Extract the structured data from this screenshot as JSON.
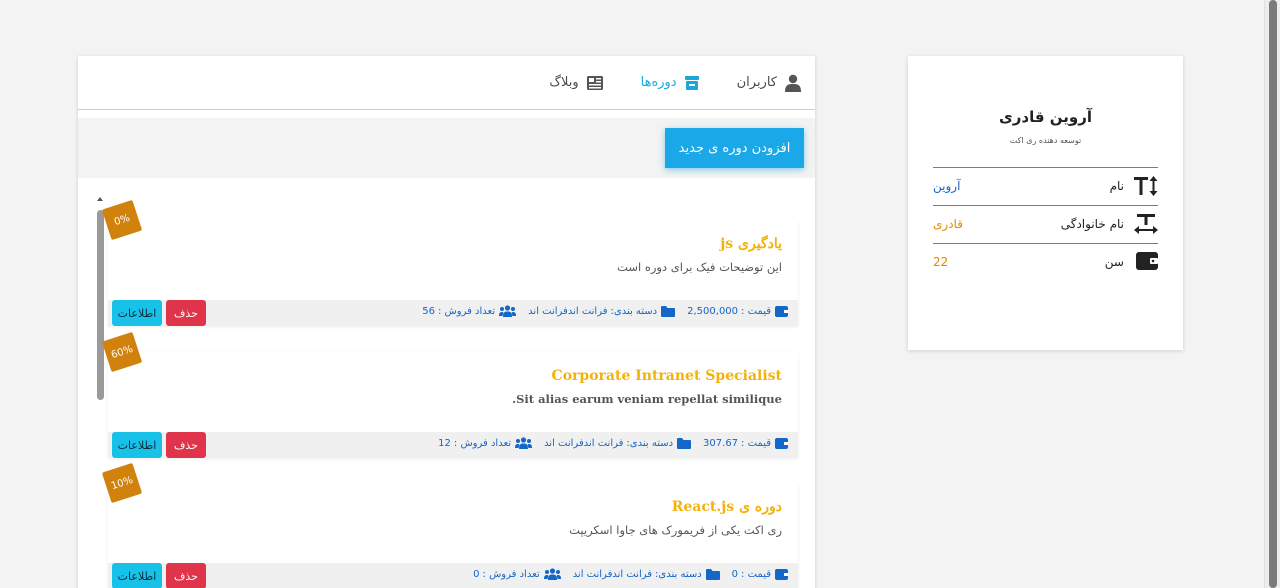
{
  "nav": {
    "users": "کاربران",
    "courses": "دوره‌ها",
    "blog": "وبلاگ"
  },
  "actions": {
    "add_course": "افزودن دوره ی جدید"
  },
  "labels": {
    "price": "قیمت :",
    "category": "دسته بندی:",
    "sales": "تعداد فروش :",
    "delete": "حذف",
    "info": "اطلاعات"
  },
  "courses": [
    {
      "badge": "0%",
      "title": "یادگیری js",
      "description": "این توضیحات فیک برای دوره است",
      "price": "2,500,000",
      "category": "فرانت اندفرانت اند",
      "sales": "56"
    },
    {
      "badge": "60%",
      "title": "Corporate Intranet Specialist",
      "description": "Sit alias earum veniam repellat similique.",
      "price": "307.67",
      "category": "فرانت اندفرانت اند",
      "sales": "12"
    },
    {
      "badge": "10%",
      "title": "دوره ی React.js",
      "description": "ری اکت یکی از فریمورک های جاوا اسکریپت",
      "price": "0",
      "category": "فرانت اندفرانت اند",
      "sales": "0"
    }
  ],
  "profile": {
    "name": "آروین قادری",
    "title": "توسعه دهنده ری اکت",
    "rows": [
      {
        "label": "نام",
        "value": "آروین",
        "color": "#1466c8",
        "icon": "text-height-icon"
      },
      {
        "label": "نام خانوادگی",
        "value": "قادری",
        "color": "#e08a00",
        "icon": "text-width-icon"
      },
      {
        "label": "سن",
        "value": "22",
        "color": "#e08a00",
        "icon": "wallet-icon"
      }
    ]
  },
  "colors": {
    "accent": "#1aa8e8",
    "title": "#f3b20a",
    "badge": "#d1820c",
    "delete": "#e0344a",
    "info": "#17c1e8",
    "link": "#1466c8"
  }
}
